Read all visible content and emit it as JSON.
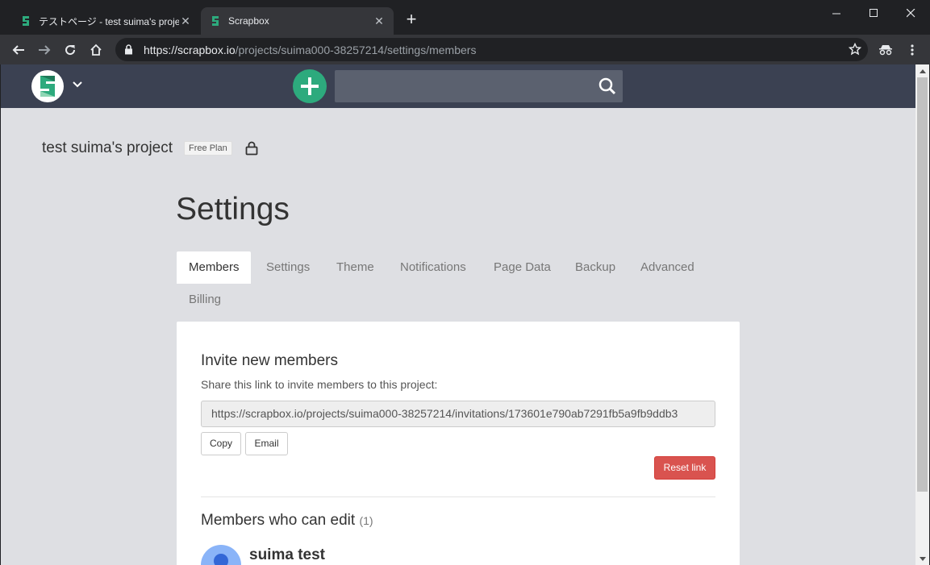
{
  "browser": {
    "tabs": [
      {
        "title": "テストページ - test suima's project",
        "active": false
      },
      {
        "title": "Scrapbox",
        "active": true
      }
    ],
    "new_tab": "+",
    "url": {
      "scheme": "https://",
      "host": "scrapbox.io",
      "path": "/projects/suima000-38257214/settings/members"
    }
  },
  "app": {
    "brand_color": "#2daa7d",
    "nav_color": "#3b4152"
  },
  "project": {
    "name": "test suima's project",
    "plan": "Free Plan"
  },
  "settings": {
    "title": "Settings",
    "tabs": [
      {
        "label": "Members",
        "active": true
      },
      {
        "label": "Settings"
      },
      {
        "label": "Theme"
      },
      {
        "label": "Notifications"
      },
      {
        "label": "Page Data"
      },
      {
        "label": "Backup"
      },
      {
        "label": "Advanced"
      },
      {
        "label": "Billing"
      }
    ]
  },
  "invite": {
    "heading": "Invite new members",
    "help": "Share this link to invite members to this project:",
    "link": "https://scrapbox.io/projects/suima000-38257214/invitations/173601e790ab7291fb5a9fb9ddb3",
    "copy_label": "Copy",
    "email_label": "Email",
    "reset_label": "Reset link",
    "reset_color": "#d9534f"
  },
  "members": {
    "heading": "Members who can edit",
    "count": "(1)",
    "list": [
      {
        "name": "suima test"
      }
    ]
  }
}
